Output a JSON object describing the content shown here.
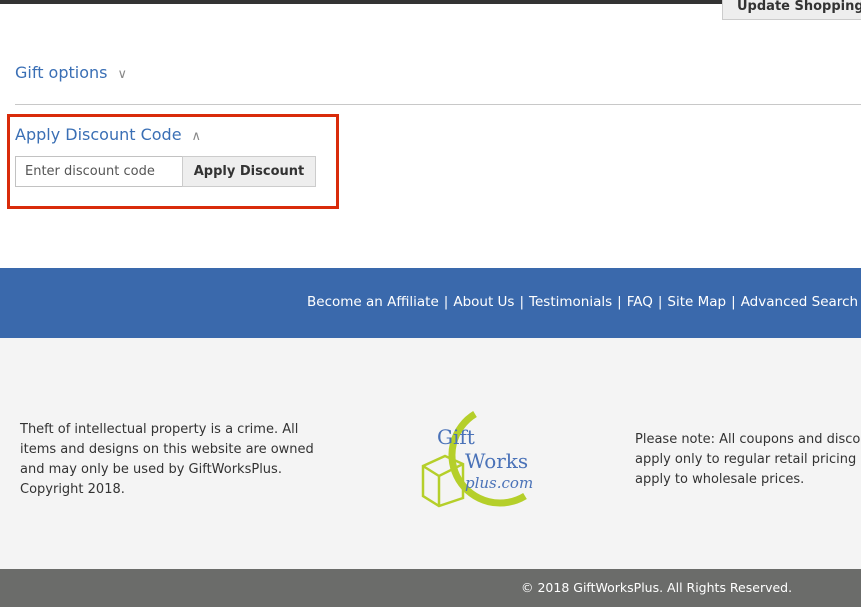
{
  "header": {
    "update_cart_label": "Update Shopping C"
  },
  "gift_options": {
    "label": "Gift options",
    "icon": "chevron-down-icon"
  },
  "discount": {
    "title": "Apply Discount Code",
    "icon": "chevron-up-icon",
    "placeholder": "Enter discount code",
    "value": "",
    "apply_label": "Apply Discount",
    "highlight_color": "#d92b0a"
  },
  "footer_links": [
    "Become an Affiliate",
    "About Us",
    "Testimonials",
    "FAQ",
    "Site Map",
    "Advanced Search"
  ],
  "footer": {
    "left_text": "Theft of intellectual property is a crime. All items and designs on this website are owned and may only be used by GiftWorksPlus. Copyright 2018.",
    "right_lines": [
      "Please note: All coupons and discou",
      "apply only to regular retail pricing a",
      "apply to wholesale prices."
    ],
    "logo_text": "GiftWorksplus.com",
    "copyright": "© 2018 GiftWorksPlus. All Rights Reserved."
  },
  "colors": {
    "link_blue": "#3a6fb5",
    "link_bar": "#3a69ac",
    "footer_bg": "#f4f4f4",
    "bottom_bar": "#6b6c6a"
  }
}
